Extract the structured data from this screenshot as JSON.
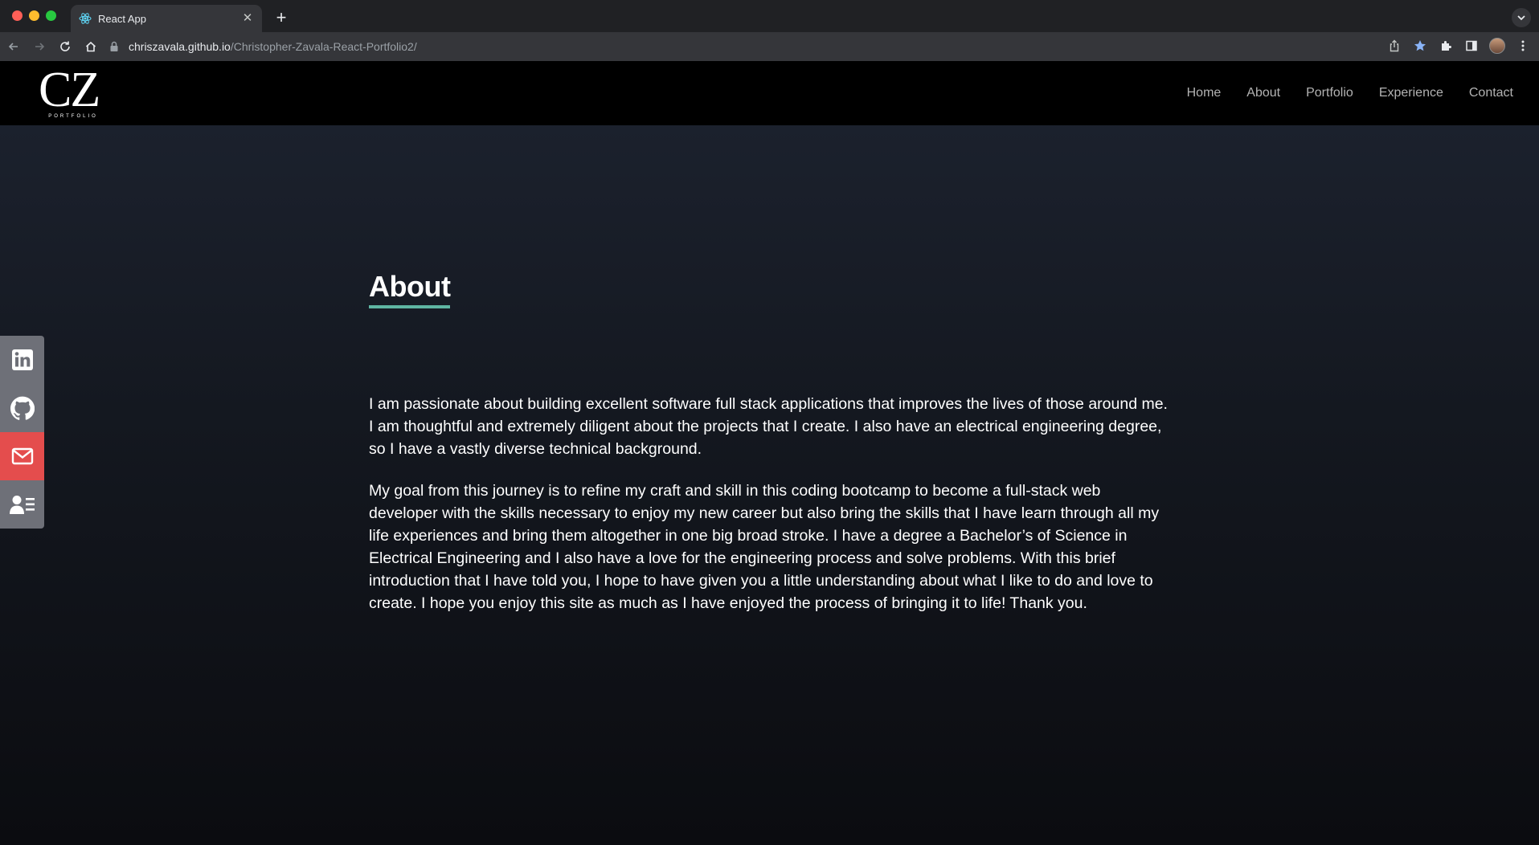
{
  "browser": {
    "tab_title": "React App",
    "url_host": "chriszavala.github.io",
    "url_path": "/Christopher-Zavala-React-Portfolio2/"
  },
  "site": {
    "logo_mark": "CZ",
    "logo_sub": "PORTFOLIO",
    "menu": [
      "Home",
      "About",
      "Portfolio",
      "Experience",
      "Contact"
    ]
  },
  "about": {
    "heading": "About",
    "paragraph1": "I am passionate about building excellent software full stack applications that improves the lives of those around me. I am thoughtful and extremely diligent about the projects that I create. I also have an electrical engineering degree, so I have a vastly diverse technical background.",
    "paragraph2": "My goal from this journey is to refine my craft and skill in this coding bootcamp to become a full-stack web developer with the skills necessary to enjoy my new career but also bring the skills that I have learn through all my life experiences and bring them altogether in one big broad stroke. I have a degree a Bachelor’s of Science in Electrical Engineering and I also have a love for the engineering process and solve problems. With this brief introduction that I have told you, I hope to have given you a little understanding about what I like to do and love to create. I hope you enjoy this site as much as I have enjoyed the process of bringing it to life! Thank you."
  },
  "social": [
    "linkedin-icon",
    "github-icon",
    "mail-icon",
    "resume-icon"
  ],
  "colors": {
    "accent_underline": "#5fb6a3",
    "email_bg": "#e44d4d",
    "social_bg": "#6e7078"
  }
}
